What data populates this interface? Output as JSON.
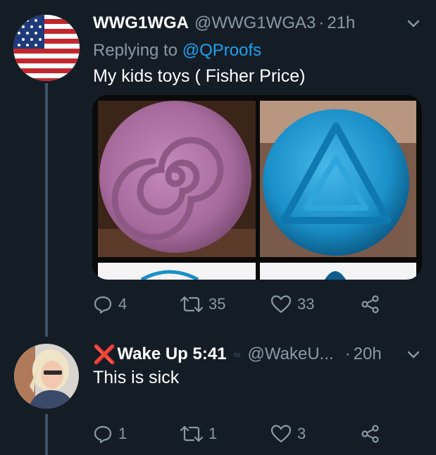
{
  "tweet1": {
    "display_name": "WWG1WGA",
    "handle": "@WWG1WGA3",
    "separator": "·",
    "time": "21h",
    "replying_prefix": "Replying to",
    "replying_mention": "@QProofs",
    "text": "My kids toys ( Fisher Price)",
    "reply_count": "4",
    "retweet_count": "35",
    "like_count": "33"
  },
  "tweet2": {
    "name_prefix": "❌",
    "display_name": "Wake Up 5:41",
    "muted_glyph": "∞",
    "handle": "@WakeU...",
    "separator": "·",
    "time": "20h",
    "text": "This is sick",
    "reply_count": "1",
    "retweet_count": "1",
    "like_count": "3"
  },
  "colors": {
    "background": "#141d26",
    "secondary_text": "#8899a6",
    "link": "#1da1f2",
    "thread_line": "#3d5466",
    "x_mark": "#e0245e"
  },
  "icons": {
    "chevron": "chevron-down-icon",
    "reply": "reply-icon",
    "retweet": "retweet-icon",
    "like": "heart-icon",
    "share": "share-icon"
  }
}
